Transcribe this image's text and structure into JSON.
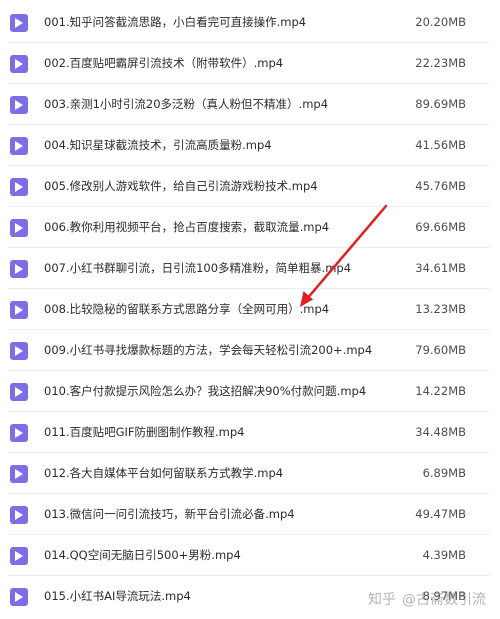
{
  "files": [
    {
      "name": "001.知乎问答截流思路，小白看完可直接操作.mp4",
      "size": "20.20MB"
    },
    {
      "name": "002.百度贴吧霸屏引流技术（附带软件）.mp4",
      "size": "22.23MB"
    },
    {
      "name": "003.亲测1小时引流20多泛粉（真人粉但不精准）.mp4",
      "size": "89.69MB"
    },
    {
      "name": "004.知识星球截流技术，引流高质量粉.mp4",
      "size": "41.56MB"
    },
    {
      "name": "005.修改别人游戏软件，给自己引流游戏粉技术.mp4",
      "size": "45.76MB"
    },
    {
      "name": "006.教你利用视频平台，抢占百度搜索，截取流量.mp4",
      "size": "69.66MB"
    },
    {
      "name": "007.小红书群聊引流，日引流100多精准粉，简单粗暴.mp4",
      "size": "34.61MB"
    },
    {
      "name": "008.比较隐秘的留联系方式思路分享（全网可用）.mp4",
      "size": "13.23MB"
    },
    {
      "name": "009.小红书寻找爆款标题的方法，学会每天轻松引流200+.mp4",
      "size": "79.60MB"
    },
    {
      "name": "010.客户付款提示风险怎么办？我这招解决90%付款问题.mp4",
      "size": "14.22MB"
    },
    {
      "name": "011.百度贴吧GIF防删图制作教程.mp4",
      "size": "34.48MB"
    },
    {
      "name": "012.各大自媒体平台如何留联系方式教学.mp4",
      "size": "6.89MB"
    },
    {
      "name": "013.微信问一问引流技巧，新平台引流必备.mp4",
      "size": "49.47MB"
    },
    {
      "name": "014.QQ空间无脑日引500+男粉.mp4",
      "size": "4.39MB"
    },
    {
      "name": "015.小红书AI导流玩法.mp4",
      "size": "8.97MB"
    }
  ],
  "watermark": {
    "site": "知乎",
    "author": "@古斋数引流"
  },
  "colors": {
    "icon": "#7b6ee6",
    "arrow": "#e02020",
    "text": "#2b2b2b"
  },
  "icons": {
    "file": "play-video-icon"
  }
}
